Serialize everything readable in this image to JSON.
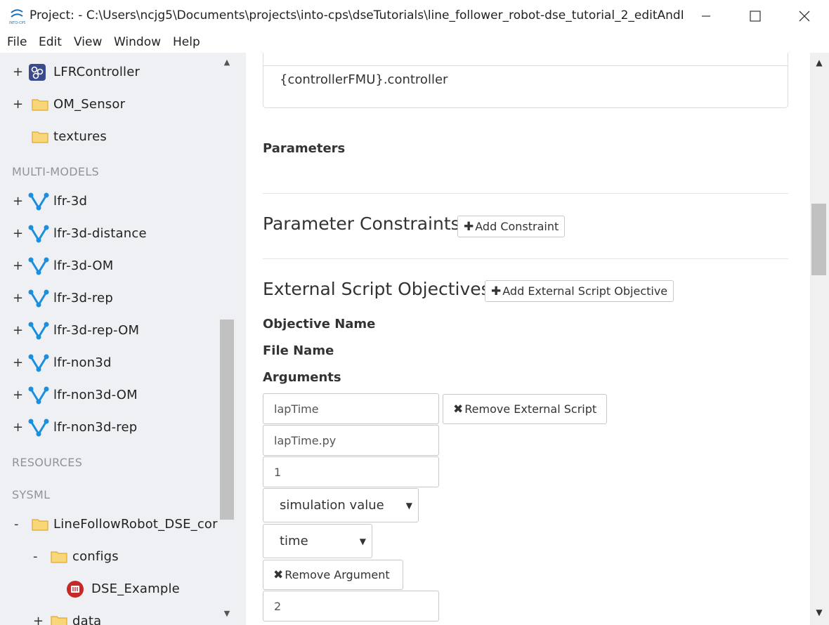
{
  "window": {
    "title": "Project: - C:\\Users\\ncjg5\\Documents\\projects\\into-cps\\dseTutorials\\line_follower_robot-dse_tutorial_2_editAndLaun...",
    "app_icon": "into-cps-logo-icon"
  },
  "menu": [
    "File",
    "Edit",
    "View",
    "Window",
    "Help"
  ],
  "sidebar": {
    "top_items": [
      {
        "toggle": "+",
        "icon": "fmu-icon",
        "label": "LFRController"
      },
      {
        "toggle": "+",
        "icon": "folder-icon",
        "label": "OM_Sensor"
      },
      {
        "toggle": "",
        "icon": "folder-icon",
        "label": "textures"
      }
    ],
    "multimodels_label": "MULTI-MODELS",
    "multimodels": [
      {
        "toggle": "+",
        "label": "lfr-3d"
      },
      {
        "toggle": "+",
        "label": "lfr-3d-distance"
      },
      {
        "toggle": "+",
        "label": "lfr-3d-OM"
      },
      {
        "toggle": "+",
        "label": "lfr-3d-rep"
      },
      {
        "toggle": "+",
        "label": "lfr-3d-rep-OM"
      },
      {
        "toggle": "+",
        "label": "lfr-non3d"
      },
      {
        "toggle": "+",
        "label": "lfr-non3d-OM"
      },
      {
        "toggle": "+",
        "label": "lfr-non3d-rep"
      }
    ],
    "resources_label": "RESOURCES",
    "sysml_label": "SYSML",
    "sysml_items": [
      {
        "toggle": "-",
        "label": "LineFollowRobot_DSE_cor"
      },
      {
        "toggle": "-",
        "label": "configs"
      },
      {
        "toggle": "",
        "label": "DSE_Example"
      },
      {
        "toggle": "+",
        "label": "data"
      }
    ]
  },
  "main": {
    "controller_text": "{controllerFMU}.controller",
    "parameters_heading": "Parameters",
    "constraints_heading": "Parameter Constraints",
    "add_constraint_label": "Add Constraint",
    "external_heading": "External Script Objectives",
    "add_external_label": "Add External Script Objective",
    "objective_name_label": "Objective Name",
    "file_name_label": "File Name",
    "arguments_label": "Arguments",
    "objective_name_value": "lapTime",
    "remove_script_label": "Remove External Script",
    "file_name_value": "lapTime.py",
    "arg1_value": "1",
    "arg_type_select": "simulation value",
    "arg_value_select": "time",
    "remove_argument_label": "Remove Argument",
    "arg2_value": "2"
  },
  "colors": {
    "sidebar_bg": "#eef0f3",
    "multimodel_icon": "#1a8fe0",
    "folder_icon": "#f5c242",
    "section_label": "#8e949a"
  }
}
